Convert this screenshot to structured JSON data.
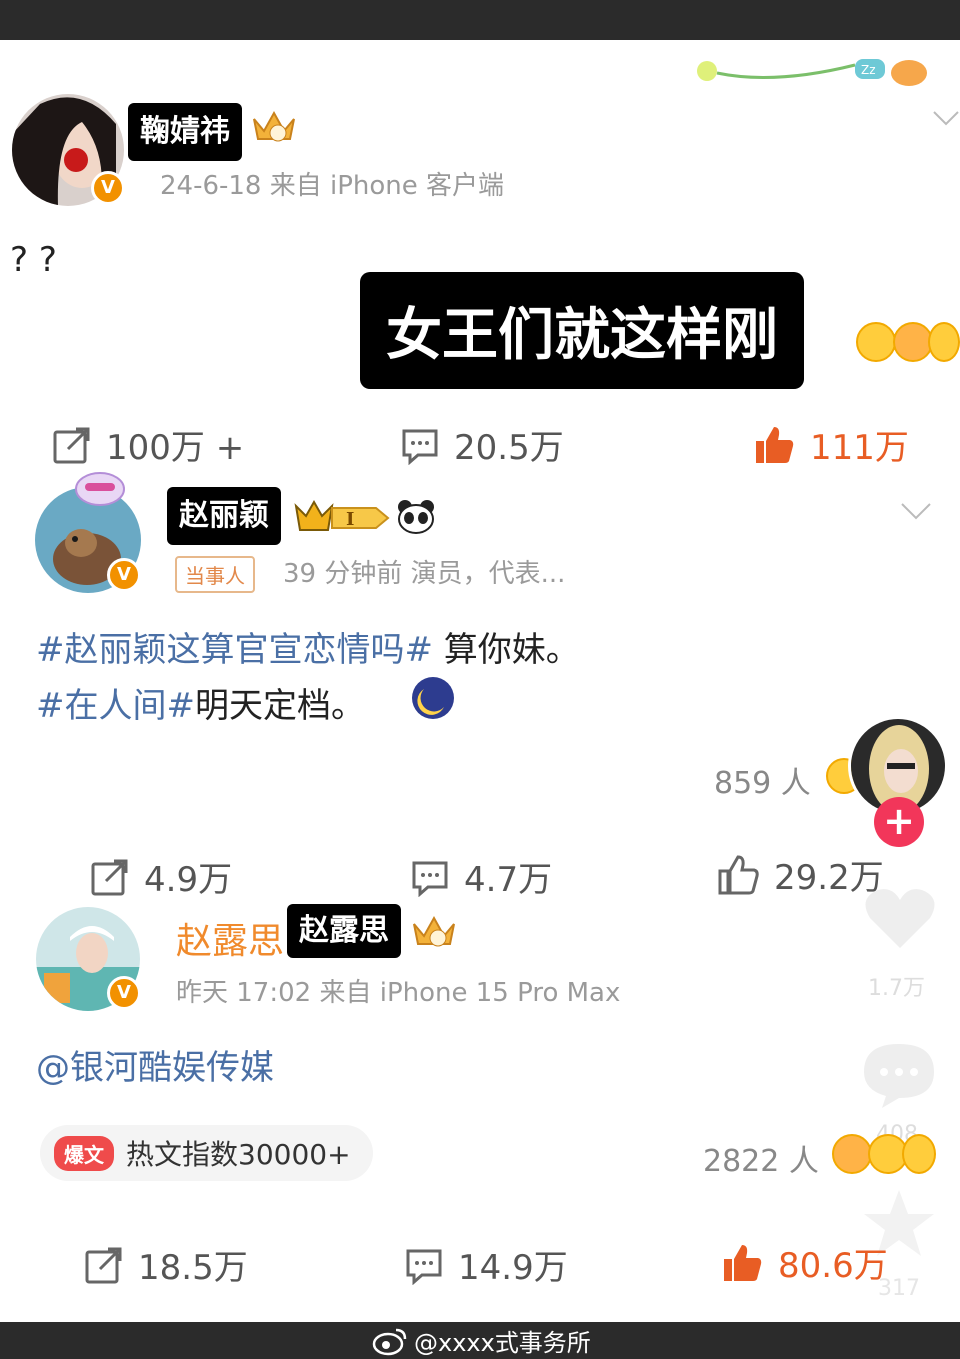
{
  "post1": {
    "name": "鞠婧祎",
    "meta": "24-6-18  来自 iPhone 客户端",
    "text": "? ?",
    "caption": "女王们就这样刚",
    "repost": "100万 +",
    "comment": "20.5万",
    "like": "111万"
  },
  "post2": {
    "name": "赵丽颖",
    "badge": "当事人",
    "meta": "39 分钟前  演员，代表...",
    "line1_tag": "#赵丽颖这算官宣恋情吗#",
    "line1_text": " 算你妹。",
    "line2_tag": "#在人间#",
    "line2_text": "明天定档。",
    "reactions": "859 人",
    "repost": "4.9万",
    "comment": "4.7万",
    "like": "29.2万"
  },
  "post3": {
    "name_orange": "赵露思",
    "name_box": "赵露思",
    "meta": "昨天 17:02  来自 iPhone 15 Pro Max",
    "text": "@银河酷娱传媒",
    "hot_tag": "爆文",
    "hot_text": "热文指数30000+",
    "reactions": "2822 人",
    "repost": "18.5万",
    "comment": "14.9万",
    "like": "80.6万"
  },
  "side": {
    "like_count": "1.7万",
    "comment_count": "408",
    "star_count": "317"
  },
  "watermark": "@xxxx式事务所",
  "colors": {
    "liked": "#e85d24",
    "tag": "#4a6fa5",
    "verified": "#f29100",
    "follow": "#f2365a"
  }
}
